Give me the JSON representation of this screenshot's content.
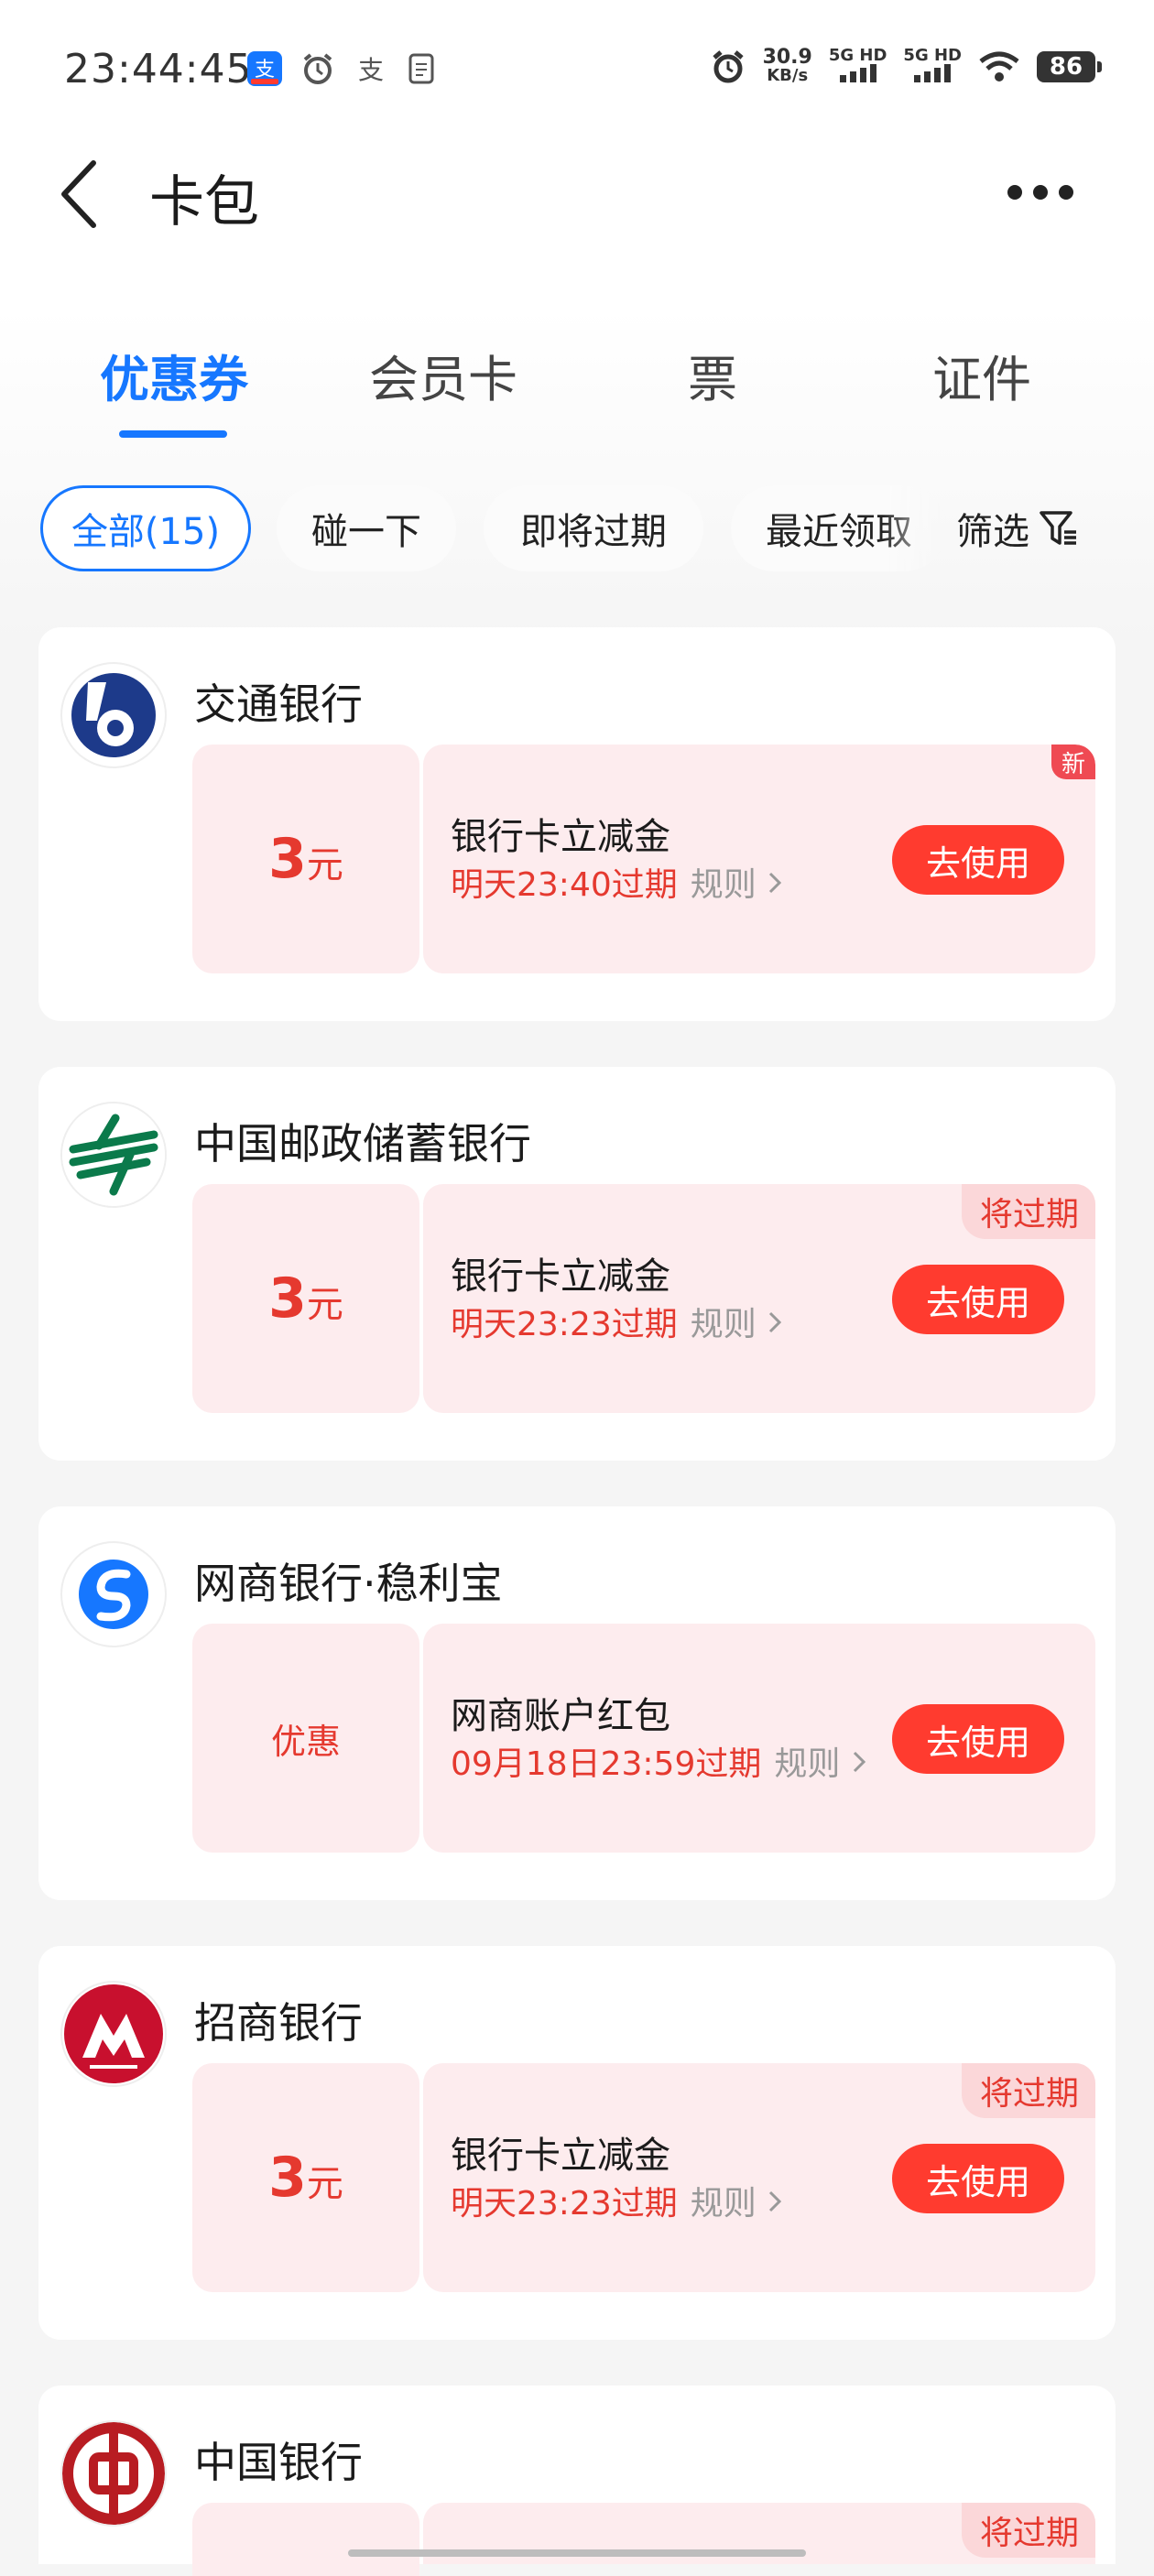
{
  "status_bar": {
    "time": "23:44:45",
    "speed_value": "30.9",
    "speed_unit": "KB/s",
    "signal1": "5G HD",
    "signal2": "5G HD",
    "battery": "86"
  },
  "header": {
    "title": "卡包"
  },
  "tabs": [
    {
      "label": "优惠券"
    },
    {
      "label": "会员卡"
    },
    {
      "label": "票"
    },
    {
      "label": "证件"
    }
  ],
  "chips": [
    {
      "label": "全部(15)"
    },
    {
      "label": "碰一下"
    },
    {
      "label": "即将过期"
    },
    {
      "label": "最近领取"
    }
  ],
  "filter_label": "筛选",
  "cards": [
    {
      "bank": "交通银行",
      "amount": "3",
      "unit": "元",
      "title": "银行卡立减金",
      "expire": "明天23:40过期",
      "rule": "规则",
      "button": "去使用",
      "tag": "新"
    },
    {
      "bank": "中国邮政储蓄银行",
      "amount": "3",
      "unit": "元",
      "title": "银行卡立减金",
      "expire": "明天23:23过期",
      "rule": "规则",
      "button": "去使用",
      "tag": "将过期"
    },
    {
      "bank": "网商银行·稳利宝",
      "promo": "优惠",
      "title": "网商账户红包",
      "expire": "09月18日23:59过期",
      "rule": "规则",
      "button": "去使用"
    },
    {
      "bank": "招商银行",
      "amount": "3",
      "unit": "元",
      "title": "银行卡立减金",
      "expire": "明天23:23过期",
      "rule": "规则",
      "button": "去使用",
      "tag": "将过期"
    },
    {
      "bank": "中国银行",
      "tag": "将过期"
    }
  ],
  "colors": {
    "accent": "#1677ff",
    "red": "#e5392f",
    "button": "#ff3b2f",
    "coupon_bg": "#fdecee"
  }
}
